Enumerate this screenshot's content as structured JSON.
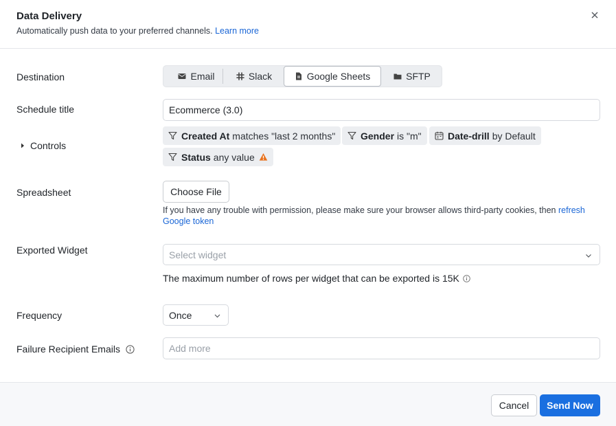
{
  "header": {
    "title": "Data Delivery",
    "subtitle": "Automatically push data to your preferred channels.",
    "learn_more": "Learn more"
  },
  "destination": {
    "label": "Destination",
    "options": [
      "Email",
      "Slack",
      "Google Sheets",
      "SFTP"
    ],
    "selected": "Google Sheets"
  },
  "schedule_title": {
    "label": "Schedule title",
    "value": "Ecommerce (3.0)"
  },
  "controls": {
    "label": "Controls",
    "filters": [
      {
        "field": "Created At",
        "condition": "matches \"last 2 months\"",
        "icon": "filter-icon"
      },
      {
        "field": "Gender",
        "condition": "is \"m\"",
        "icon": "filter-icon"
      },
      {
        "field": "Date-drill",
        "condition": "by Default",
        "icon": "calendar-icon"
      },
      {
        "field": "Status",
        "condition": "any value",
        "icon": "filter-icon",
        "warning": true
      }
    ]
  },
  "spreadsheet": {
    "label": "Spreadsheet",
    "button": "Choose File",
    "help_text": "If you have any trouble with permission, please make sure your browser allows third-party cookies, then",
    "help_link": "refresh Google token"
  },
  "exported_widget": {
    "label": "Exported Widget",
    "placeholder": "Select widget",
    "note": "The maximum number of rows per widget that can be exported is 15K"
  },
  "frequency": {
    "label": "Frequency",
    "value": "Once"
  },
  "failure_emails": {
    "label": "Failure Recipient Emails",
    "placeholder": "Add more"
  },
  "footer": {
    "cancel": "Cancel",
    "send": "Send Now"
  },
  "colors": {
    "primary": "#1a6fe0",
    "link": "#1a66d6",
    "warning": "#e8711c"
  }
}
